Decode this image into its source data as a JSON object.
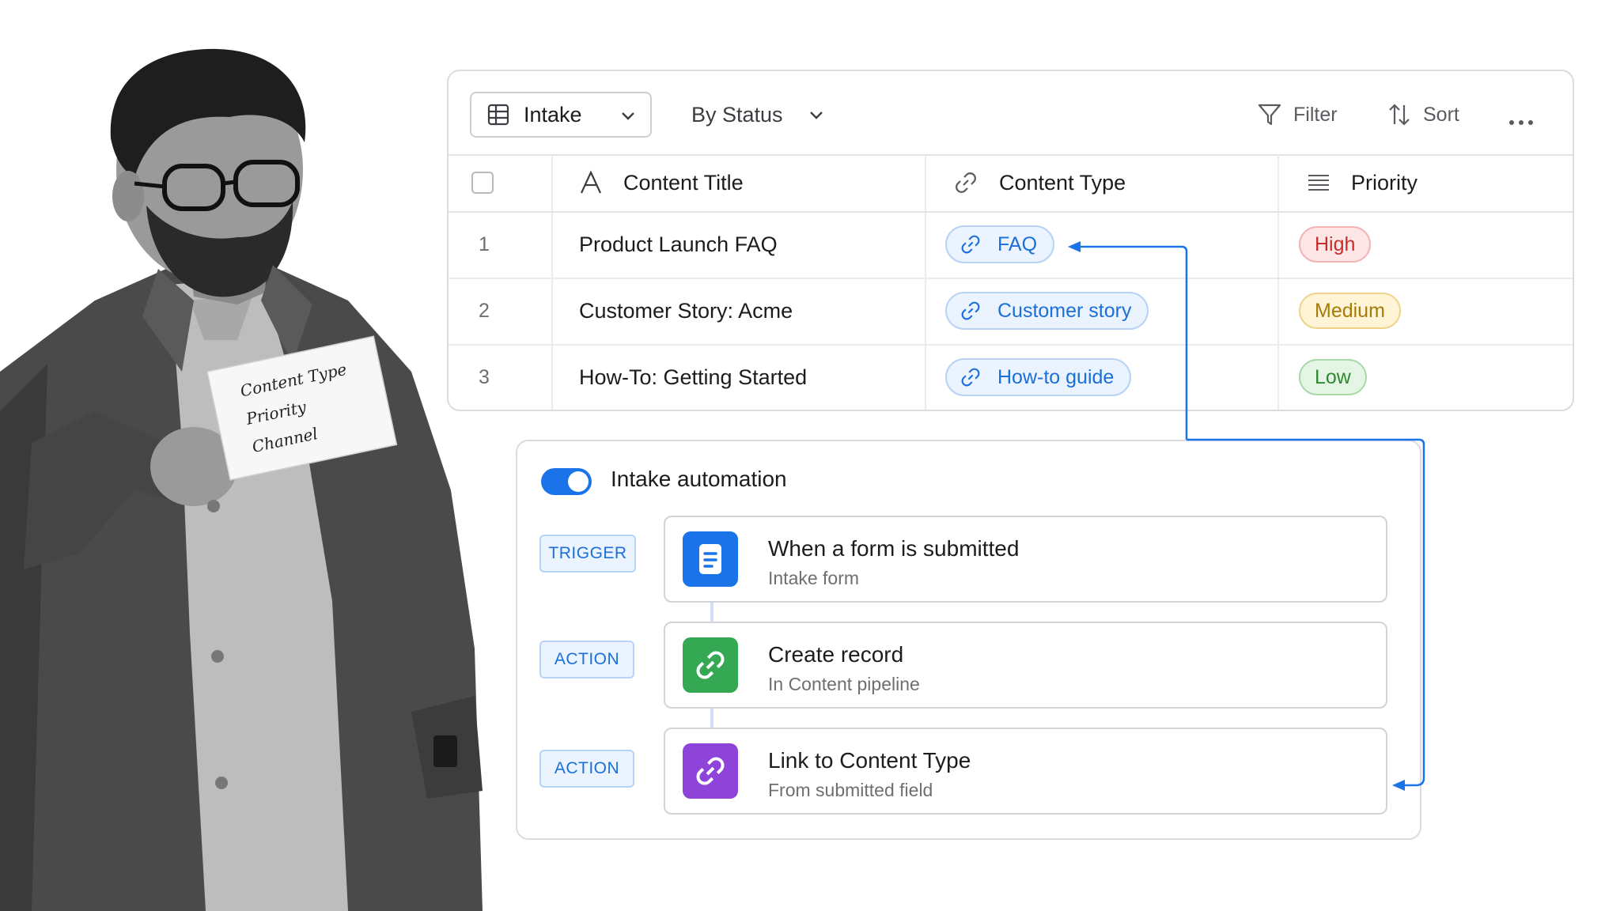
{
  "person_card": {
    "lines": [
      "Content Type",
      "Priority",
      "Channel"
    ]
  },
  "table": {
    "toolbar": {
      "view_label": "Intake",
      "group_label": "By Status",
      "filter_label": "Filter",
      "sort_label": "Sort",
      "more_label": "···"
    },
    "columns": {
      "title": "Content Title",
      "type": "Content Type",
      "priority": "Priority"
    },
    "rows": [
      {
        "num": "1",
        "title": "Product Launch FAQ",
        "type": "FAQ",
        "priority": "High"
      },
      {
        "num": "2",
        "title": "Customer Story: Acme",
        "type": "Customer story",
        "priority": "Medium"
      },
      {
        "num": "3",
        "title": "How-To: Getting Started",
        "type": "How-to guide",
        "priority": "Low"
      }
    ]
  },
  "automation": {
    "title": "Intake automation",
    "enabled": true,
    "steps": [
      {
        "tag": "TRIGGER",
        "title": "When a form is submitted",
        "subtitle": "Intake form",
        "icon": "form-icon",
        "color": "#1a73e8"
      },
      {
        "tag": "ACTION",
        "title": "Create record",
        "subtitle": "In  Content pipeline",
        "icon": "link-icon",
        "color": "#34a853"
      },
      {
        "tag": "ACTION",
        "title": "Link to Content Type",
        "subtitle": "From submitted field",
        "icon": "link-icon",
        "color": "#8e44d9"
      }
    ]
  },
  "colors": {
    "accent": "#1a73e8",
    "high": "#c72d2d",
    "medium": "#a67a06",
    "low": "#2d8a2f"
  }
}
